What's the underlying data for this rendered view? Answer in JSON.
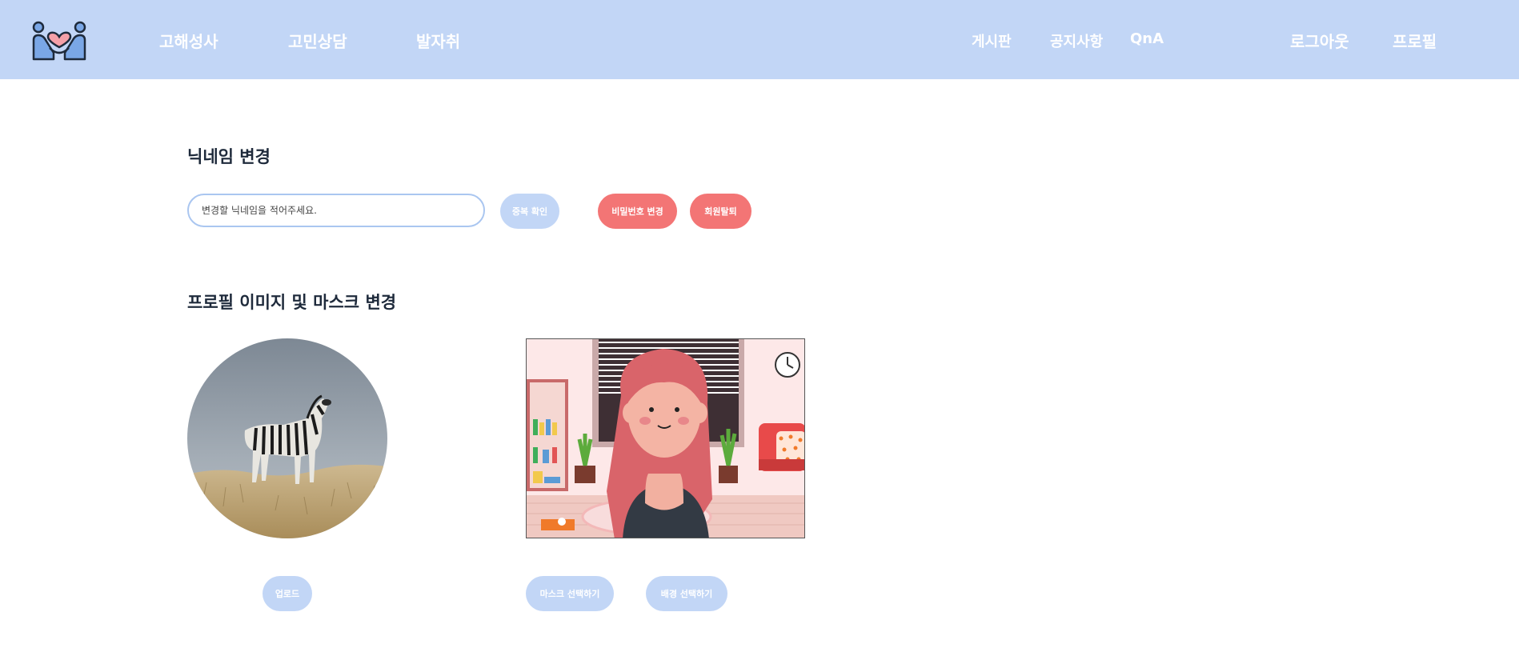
{
  "nav": {
    "left": [
      "고해성사",
      "고민상담",
      "발자취"
    ],
    "right": [
      "게시판",
      "공지사항",
      "QnA"
    ],
    "account": [
      "로그아웃",
      "프로필"
    ]
  },
  "nickname": {
    "title": "닉네임 변경",
    "placeholder": "변경할 닉네임을 적어주세요.",
    "check_button": "중복 확인",
    "password_button": "비밀번호 변경",
    "withdraw_button": "회원탈퇴"
  },
  "profile": {
    "title": "프로필 이미지 및 마스크 변경",
    "upload_button": "업로드",
    "mask_button": "마스크 선택하기",
    "background_button": "배경 선택하기"
  },
  "colors": {
    "header": "#c2d6f6",
    "accent_blue": "#c2d6f6",
    "accent_red": "#f37575",
    "title_text": "#1e2a3b"
  },
  "icons": {
    "logo": "couple-heart-logo-icon"
  }
}
